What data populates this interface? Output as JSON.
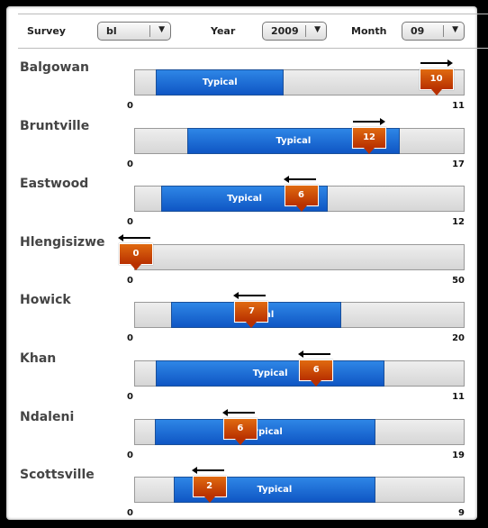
{
  "filters": {
    "survey": {
      "label": "Survey",
      "value": "bl"
    },
    "year": {
      "label": "Year",
      "value": "2009"
    },
    "month": {
      "label": "Month",
      "value": "09"
    }
  },
  "colors": {
    "typical": "#1a6fd8",
    "marker": "#c84200",
    "track": "#e0e0e0"
  },
  "rows": [
    {
      "name": "Balgowan",
      "min": 0,
      "max": 11,
      "typical": [
        0.7,
        4.95
      ],
      "typical_label": "Typical",
      "value": 10,
      "trend": "up"
    },
    {
      "name": "Bruntville",
      "min": 0,
      "max": 17,
      "typical": [
        2.7,
        13.6
      ],
      "typical_label": "Typical",
      "value": 12,
      "trend": "up"
    },
    {
      "name": "Eastwood",
      "min": 0,
      "max": 12,
      "typical": [
        0.95,
        7.0
      ],
      "typical_label": "Typical",
      "value": 6,
      "trend": "down"
    },
    {
      "name": "Hlengisizwe",
      "min": 0,
      "max": 50,
      "typical": null,
      "typical_label": "",
      "value": 0,
      "trend": "down"
    },
    {
      "name": "Howick",
      "min": 0,
      "max": 20,
      "typical": [
        2.2,
        12.5
      ],
      "typical_label": "Typical",
      "value": 7,
      "trend": "down"
    },
    {
      "name": "Khan",
      "min": 0,
      "max": 11,
      "typical": [
        0.7,
        8.3
      ],
      "typical_label": "Typical",
      "value": 6,
      "trend": "down"
    },
    {
      "name": "Ndaleni",
      "min": 0,
      "max": 19,
      "typical": [
        1.15,
        13.8
      ],
      "typical_label": "Typical",
      "value": 6,
      "trend": "down"
    },
    {
      "name": "Scottsville",
      "min": 0,
      "max": 9,
      "typical": [
        1.05,
        6.55
      ],
      "typical_label": "Typical",
      "value": 2,
      "trend": "down"
    }
  ]
}
